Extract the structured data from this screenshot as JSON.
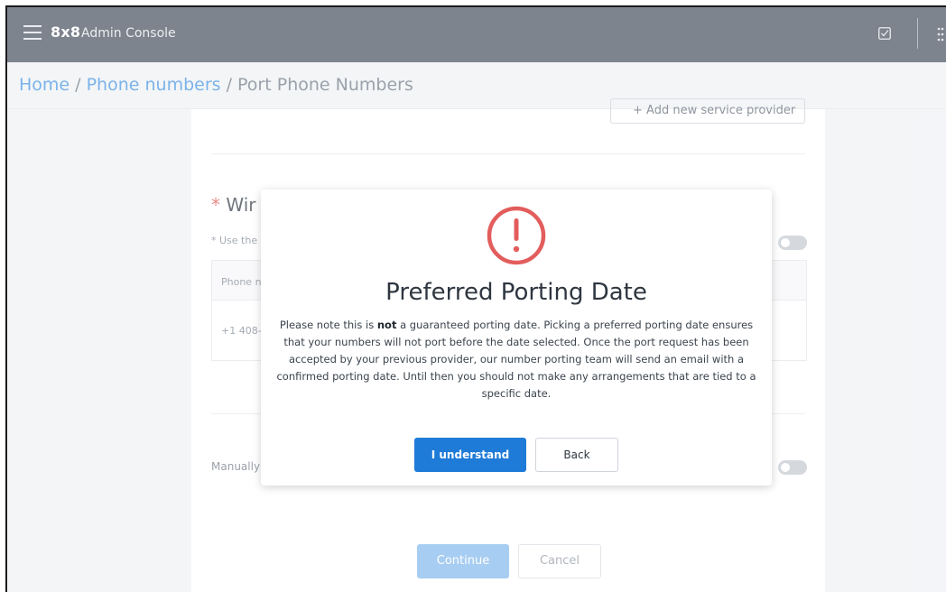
{
  "topbar": {
    "brand": "8x8",
    "product": "Admin Console",
    "icons": [
      "menu-icon",
      "task-check-icon",
      "apps-grid-icon"
    ]
  },
  "breadcrumb": {
    "home": "Home",
    "sep1": " / ",
    "phone_numbers": "Phone numbers",
    "sep2": " / ",
    "current": "Port Phone Numbers"
  },
  "background_form": {
    "add_provider_label": "+ Add new service provider",
    "section_required_mark": "* ",
    "section_title_partial": "Wir",
    "hint_partial": "* Use the",
    "table_header_partial": "Phone n",
    "table_cell_partial": "+1 408-",
    "manual_label_partial": "Manually",
    "continue_label": "Continue",
    "cancel_label": "Cancel"
  },
  "modal": {
    "icon": "alert-circle-icon",
    "icon_color": "#e35d5d",
    "title": "Preferred Porting Date",
    "body_before": "Please note this is ",
    "body_bold": "not",
    "body_after": " a guaranteed porting date. Picking a preferred porting date ensures that your numbers will not port before the date selected. Once the port request has been accepted by your previous provider, our number porting team will send an email with a confirmed porting date. Until then you should not make any arrangements that are tied to a specific date.",
    "primary_label": "I understand",
    "secondary_label": "Back",
    "primary_color": "#1f7bd8"
  }
}
